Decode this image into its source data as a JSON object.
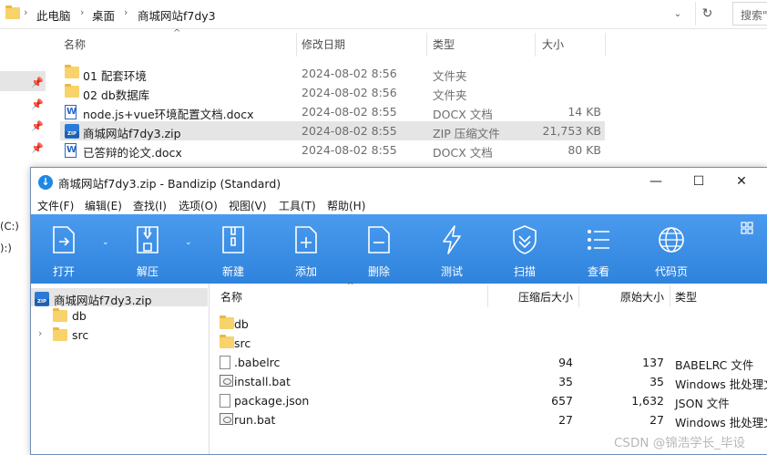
{
  "explorer": {
    "breadcrumb": [
      "此电脑",
      "桌面",
      "商城网站f7dy3"
    ],
    "search_placeholder": "搜索\"",
    "nav_drives": [
      "(C:)",
      "):)"
    ],
    "columns": {
      "name": "名称",
      "date": "修改日期",
      "type": "类型",
      "size": "大小"
    },
    "files": [
      {
        "name": "01  配套环境",
        "date": "2024-08-02 8:56",
        "type": "文件夹",
        "size": "",
        "icon": "folder-icon"
      },
      {
        "name": "02 db数据库",
        "date": "2024-08-02 8:56",
        "type": "文件夹",
        "size": "",
        "icon": "folder-icon"
      },
      {
        "name": "node.js+vue环境配置文档.docx",
        "date": "2024-08-02 8:55",
        "type": "DOCX 文档",
        "size": "14 KB",
        "icon": "docx-icon"
      },
      {
        "name": "商城网站f7dy3.zip",
        "date": "2024-08-02 8:55",
        "type": "ZIP 压缩文件",
        "size": "21,753 KB",
        "icon": "zip-icon"
      },
      {
        "name": "已答辩的论文.docx",
        "date": "2024-08-02 8:55",
        "type": "DOCX 文档",
        "size": "80 KB",
        "icon": "docx-icon"
      }
    ]
  },
  "bandizip": {
    "title": "商城网站f7dy3.zip - Bandizip (Standard)",
    "window_buttons": {
      "minimize": "—",
      "maximize": "☐",
      "close": "✕"
    },
    "menu": [
      "文件(F)",
      "编辑(E)",
      "查找(I)",
      "选项(O)",
      "视图(V)",
      "工具(T)",
      "帮助(H)"
    ],
    "toolbar": [
      {
        "label": "打开",
        "icon": "open-icon"
      },
      {
        "label": "解压",
        "icon": "extract-icon"
      },
      {
        "label": "新建",
        "icon": "new-archive-icon"
      },
      {
        "label": "添加",
        "icon": "add-icon"
      },
      {
        "label": "删除",
        "icon": "delete-icon"
      },
      {
        "label": "测试",
        "icon": "test-icon"
      },
      {
        "label": "扫描",
        "icon": "scan-icon"
      },
      {
        "label": "查看",
        "icon": "view-icon"
      },
      {
        "label": "代码页",
        "icon": "codepage-icon"
      }
    ],
    "tree": {
      "root": "商城网站f7dy3.zip",
      "children": [
        {
          "label": "db",
          "expandable": false
        },
        {
          "label": "src",
          "expandable": true
        }
      ]
    },
    "list_columns": {
      "name": "名称",
      "compressed": "压缩后大小",
      "original": "原始大小",
      "type": "类型"
    },
    "items": [
      {
        "name": "db",
        "compressed": "",
        "original": "",
        "type": "",
        "icon": "folder-icon"
      },
      {
        "name": "src",
        "compressed": "",
        "original": "",
        "type": "",
        "icon": "folder-icon"
      },
      {
        "name": ".babelrc",
        "compressed": "94",
        "original": "137",
        "type": "BABELRC 文件",
        "icon": "file-icon"
      },
      {
        "name": "install.bat",
        "compressed": "35",
        "original": "35",
        "type": "Windows 批处理文",
        "icon": "bat-icon"
      },
      {
        "name": "package.json",
        "compressed": "657",
        "original": "1,632",
        "type": "JSON 文件",
        "icon": "file-icon"
      },
      {
        "name": "run.bat",
        "compressed": "27",
        "original": "27",
        "type": "Windows 批处理文",
        "icon": "bat-icon"
      }
    ]
  },
  "watermark": "CSDN @锦浩学长_毕设",
  "colors": {
    "toolbar_blue": "#3b8ee6",
    "selection_gray": "#e5e5e5",
    "folder_yellow": "#f8d26a"
  }
}
